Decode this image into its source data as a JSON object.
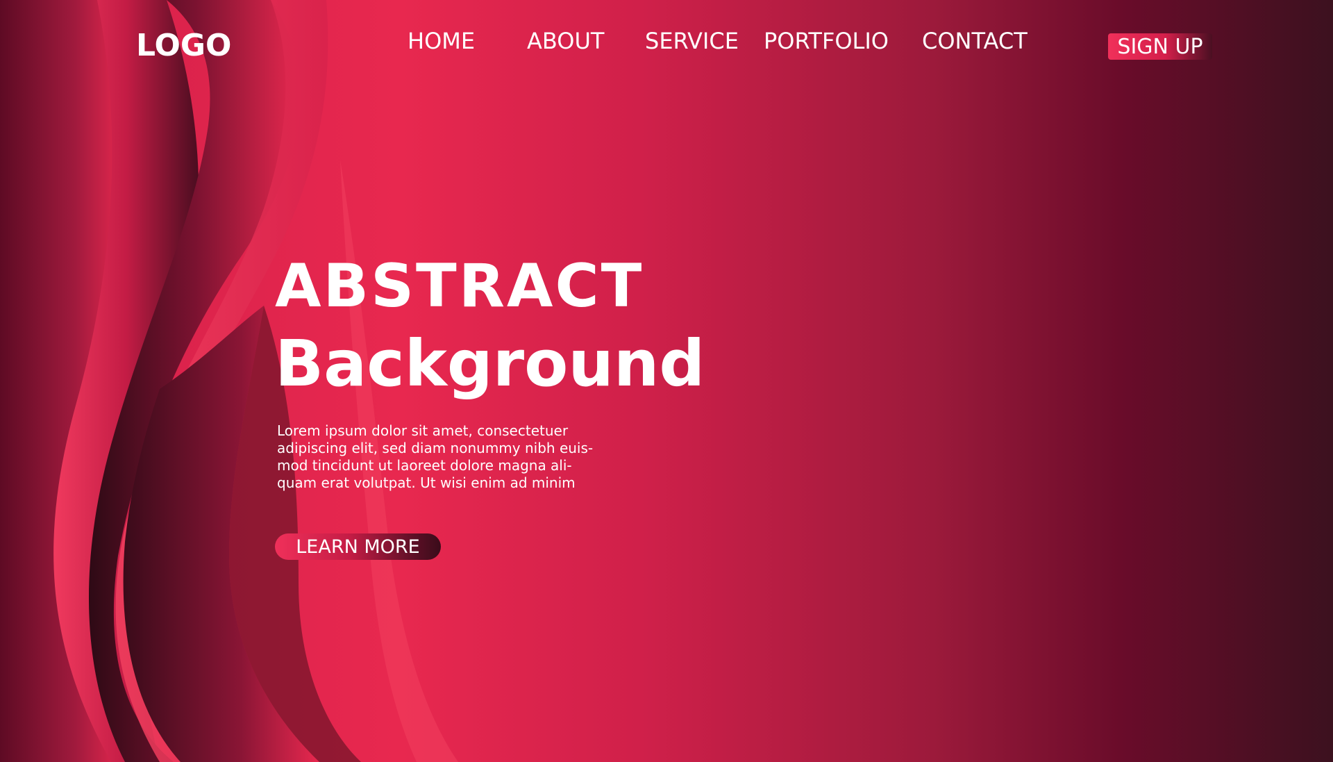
{
  "header": {
    "logo": "LOGO",
    "nav": {
      "home": "HOME",
      "about": "ABOUT",
      "service": "SERVICE",
      "portfolio": "PORTFOLIO",
      "contact": "CONTACT"
    },
    "signup_label": "SIGN UP"
  },
  "hero": {
    "title_line1": "ABSTRACT",
    "title_line2": "Background",
    "body_lines": [
      "Lorem ipsum dolor sit amet, consectetuer",
      "adipiscing elit, sed diam nonummy nibh euis-",
      "mod tincidunt ut laoreet dolore magna ali-",
      "quam erat volutpat. Ut wisi enim ad minim"
    ],
    "cta_label": "LEARN MORE"
  },
  "colors": {
    "primary": "#e8284f",
    "dark": "#3c111f",
    "deep": "#6a0c2a",
    "text": "#ffffff"
  }
}
